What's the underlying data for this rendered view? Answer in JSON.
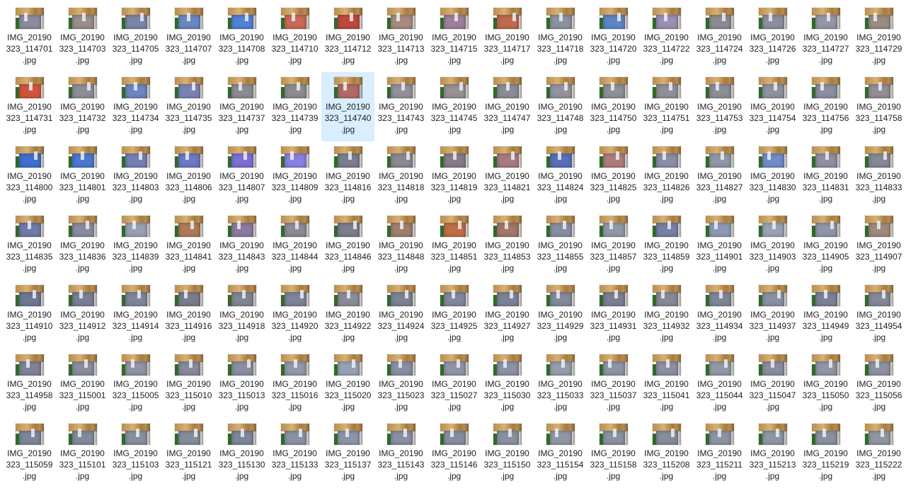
{
  "view": {
    "selected_file": "IMG_20190323_114740.jpg",
    "selected_color": "#cce8ff"
  },
  "files": [
    {
      "name": "IMG_20190323_114701.jpg",
      "thumb_color": "#8e8aa0"
    },
    {
      "name": "IMG_20190323_114703.jpg",
      "thumb_color": "#9a8e8c"
    },
    {
      "name": "IMG_20190323_114705.jpg",
      "thumb_color": "#7b86a8"
    },
    {
      "name": "IMG_20190323_114707.jpg",
      "thumb_color": "#6a86c2"
    },
    {
      "name": "IMG_20190323_114708.jpg",
      "thumb_color": "#4f82d6"
    },
    {
      "name": "IMG_20190323_114710.jpg",
      "thumb_color": "#c86a55"
    },
    {
      "name": "IMG_20190323_114712.jpg",
      "thumb_color": "#c0473f"
    },
    {
      "name": "IMG_20190323_114713.jpg",
      "thumb_color": "#a88a80"
    },
    {
      "name": "IMG_20190323_114715.jpg",
      "thumb_color": "#9f7f9a"
    },
    {
      "name": "IMG_20190323_114717.jpg",
      "thumb_color": "#c06b4c"
    },
    {
      "name": "IMG_20190323_114718.jpg",
      "thumb_color": "#8b92a2"
    },
    {
      "name": "IMG_20190323_114720.jpg",
      "thumb_color": "#5c86c4"
    },
    {
      "name": "IMG_20190323_114722.jpg",
      "thumb_color": "#9b8fb4"
    },
    {
      "name": "IMG_20190323_114724.jpg",
      "thumb_color": "#8c8a92"
    },
    {
      "name": "IMG_20190323_114726.jpg",
      "thumb_color": "#8c8fa0"
    },
    {
      "name": "IMG_20190323_114727.jpg",
      "thumb_color": "#9497a6"
    },
    {
      "name": "IMG_20190323_114729.jpg",
      "thumb_color": "#9a8c84"
    },
    {
      "name": "IMG_20190323_114731.jpg",
      "thumb_color": "#d0553f"
    },
    {
      "name": "IMG_20190323_114732.jpg",
      "thumb_color": "#8f8e98"
    },
    {
      "name": "IMG_20190323_114734.jpg",
      "thumb_color": "#6d86c0"
    },
    {
      "name": "IMG_20190323_114735.jpg",
      "thumb_color": "#7a84b4"
    },
    {
      "name": "IMG_20190323_114737.jpg",
      "thumb_color": "#8e8c92"
    },
    {
      "name": "IMG_20190323_114739.jpg",
      "thumb_color": "#8e8b90"
    },
    {
      "name": "IMG_20190323_114740.jpg",
      "thumb_color": "#b26a66"
    },
    {
      "name": "IMG_20190323_114743.jpg",
      "thumb_color": "#92909a"
    },
    {
      "name": "IMG_20190323_114745.jpg",
      "thumb_color": "#9a9094"
    },
    {
      "name": "IMG_20190323_114747.jpg",
      "thumb_color": "#8c8c96"
    },
    {
      "name": "IMG_20190323_114748.jpg",
      "thumb_color": "#9494a0"
    },
    {
      "name": "IMG_20190323_114750.jpg",
      "thumb_color": "#8e9098"
    },
    {
      "name": "IMG_20190323_114751.jpg",
      "thumb_color": "#90909a"
    },
    {
      "name": "IMG_20190323_114753.jpg",
      "thumb_color": "#8e8e98"
    },
    {
      "name": "IMG_20190323_114754.jpg",
      "thumb_color": "#8f92a0"
    },
    {
      "name": "IMG_20190323_114756.jpg",
      "thumb_color": "#8a8e9e"
    },
    {
      "name": "IMG_20190323_114758.jpg",
      "thumb_color": "#928e94"
    },
    {
      "name": "IMG_20190323_114800.jpg",
      "thumb_color": "#3f6fd0"
    },
    {
      "name": "IMG_20190323_114801.jpg",
      "thumb_color": "#4a78d2"
    },
    {
      "name": "IMG_20190323_114803.jpg",
      "thumb_color": "#7480b4"
    },
    {
      "name": "IMG_20190323_114806.jpg",
      "thumb_color": "#6b79c6"
    },
    {
      "name": "IMG_20190323_114807.jpg",
      "thumb_color": "#7c6fd8"
    },
    {
      "name": "IMG_20190323_114809.jpg",
      "thumb_color": "#8a80e0"
    },
    {
      "name": "IMG_20190323_114816.jpg",
      "thumb_color": "#7a7e8e"
    },
    {
      "name": "IMG_20190323_114818.jpg",
      "thumb_color": "#8a8890"
    },
    {
      "name": "IMG_20190323_114819.jpg",
      "thumb_color": "#857d86"
    },
    {
      "name": "IMG_20190323_114821.jpg",
      "thumb_color": "#a87b82"
    },
    {
      "name": "IMG_20190323_114824.jpg",
      "thumb_color": "#5a6fb8"
    },
    {
      "name": "IMG_20190323_114825.jpg",
      "thumb_color": "#b07c7a"
    },
    {
      "name": "IMG_20190323_114826.jpg",
      "thumb_color": "#8a8ea6"
    },
    {
      "name": "IMG_20190323_114827.jpg",
      "thumb_color": "#9098a8"
    },
    {
      "name": "IMG_20190323_114830.jpg",
      "thumb_color": "#6e8cc8"
    },
    {
      "name": "IMG_20190323_114831.jpg",
      "thumb_color": "#8e90a0"
    },
    {
      "name": "IMG_20190323_114833.jpg",
      "thumb_color": "#868894"
    },
    {
      "name": "IMG_20190323_114835.jpg",
      "thumb_color": "#6f7aa8"
    },
    {
      "name": "IMG_20190323_114836.jpg",
      "thumb_color": "#8a8aa0"
    },
    {
      "name": "IMG_20190323_114839.jpg",
      "thumb_color": "#9aa0b4"
    },
    {
      "name": "IMG_20190323_114841.jpg",
      "thumb_color": "#b07a58"
    },
    {
      "name": "IMG_20190323_114843.jpg",
      "thumb_color": "#8c7aa0"
    },
    {
      "name": "IMG_20190323_114844.jpg",
      "thumb_color": "#8e8a96"
    },
    {
      "name": "IMG_20190323_114846.jpg",
      "thumb_color": "#7c7e8c"
    },
    {
      "name": "IMG_20190323_114848.jpg",
      "thumb_color": "#a07e6c"
    },
    {
      "name": "IMG_20190323_114851.jpg",
      "thumb_color": "#c06c48"
    },
    {
      "name": "IMG_20190323_114853.jpg",
      "thumb_color": "#a07868"
    },
    {
      "name": "IMG_20190323_114855.jpg",
      "thumb_color": "#8a8ca0"
    },
    {
      "name": "IMG_20190323_114857.jpg",
      "thumb_color": "#9098a8"
    },
    {
      "name": "IMG_20190323_114859.jpg",
      "thumb_color": "#7680a4"
    },
    {
      "name": "IMG_20190323_114901.jpg",
      "thumb_color": "#8c9ab8"
    },
    {
      "name": "IMG_20190323_114903.jpg",
      "thumb_color": "#9aa2b4"
    },
    {
      "name": "IMG_20190323_114905.jpg",
      "thumb_color": "#9096a6"
    },
    {
      "name": "IMG_20190323_114907.jpg",
      "thumb_color": "#a08a7c"
    },
    {
      "name": "IMG_20190323_114910.jpg",
      "thumb_color": "#6c7894"
    },
    {
      "name": "IMG_20190323_114912.jpg",
      "thumb_color": "#7a8094"
    },
    {
      "name": "IMG_20190323_114914.jpg",
      "thumb_color": "#7e869c"
    },
    {
      "name": "IMG_20190323_114916.jpg",
      "thumb_color": "#7a7c8c"
    },
    {
      "name": "IMG_20190323_114918.jpg",
      "thumb_color": "#828494"
    },
    {
      "name": "IMG_20190323_114920.jpg",
      "thumb_color": "#7c8498"
    },
    {
      "name": "IMG_20190323_114922.jpg",
      "thumb_color": "#8a8c98"
    },
    {
      "name": "IMG_20190323_114924.jpg",
      "thumb_color": "#7e8294"
    },
    {
      "name": "IMG_20190323_114925.jpg",
      "thumb_color": "#80889c"
    },
    {
      "name": "IMG_20190323_114927.jpg",
      "thumb_color": "#7c8296"
    },
    {
      "name": "IMG_20190323_114929.jpg",
      "thumb_color": "#828a9c"
    },
    {
      "name": "IMG_20190323_114931.jpg",
      "thumb_color": "#7a8092"
    },
    {
      "name": "IMG_20190323_114932.jpg",
      "thumb_color": "#868a98"
    },
    {
      "name": "IMG_20190323_114934.jpg",
      "thumb_color": "#7e8698"
    },
    {
      "name": "IMG_20190323_114937.jpg",
      "thumb_color": "#8890a2"
    },
    {
      "name": "IMG_20190323_114949.jpg",
      "thumb_color": "#7a8296"
    },
    {
      "name": "IMG_20190323_114954.jpg",
      "thumb_color": "#848898"
    },
    {
      "name": "IMG_20190323_114958.jpg",
      "thumb_color": "#7e8496"
    },
    {
      "name": "IMG_20190323_115001.jpg",
      "thumb_color": "#8a8e9c"
    },
    {
      "name": "IMG_20190323_115005.jpg",
      "thumb_color": "#9094a4"
    },
    {
      "name": "IMG_20190323_115010.jpg",
      "thumb_color": "#868a9a"
    },
    {
      "name": "IMG_20190323_115013.jpg",
      "thumb_color": "#8a8e9e"
    },
    {
      "name": "IMG_20190323_115016.jpg",
      "thumb_color": "#9298a8"
    },
    {
      "name": "IMG_20190323_115020.jpg",
      "thumb_color": "#98a0b4"
    },
    {
      "name": "IMG_20190323_115023.jpg",
      "thumb_color": "#8a90a2"
    },
    {
      "name": "IMG_20190323_115027.jpg",
      "thumb_color": "#9094a6"
    },
    {
      "name": "IMG_20190323_115030.jpg",
      "thumb_color": "#8c92a4"
    },
    {
      "name": "IMG_20190323_115033.jpg",
      "thumb_color": "#969caa"
    },
    {
      "name": "IMG_20190323_115037.jpg",
      "thumb_color": "#8e94a4"
    },
    {
      "name": "IMG_20190323_115041.jpg",
      "thumb_color": "#8c90a0"
    },
    {
      "name": "IMG_20190323_115044.jpg",
      "thumb_color": "#9298a6"
    },
    {
      "name": "IMG_20190323_115047.jpg",
      "thumb_color": "#8a8e9c"
    },
    {
      "name": "IMG_20190323_115050.jpg",
      "thumb_color": "#9096a4"
    },
    {
      "name": "IMG_20190323_115056.jpg",
      "thumb_color": "#8e92a0"
    },
    {
      "name": "IMG_20190323_115059.jpg",
      "thumb_color": "#7c8698"
    },
    {
      "name": "IMG_20190323_115101.jpg",
      "thumb_color": "#828a9c"
    },
    {
      "name": "IMG_20190323_115103.jpg",
      "thumb_color": "#8890a0"
    },
    {
      "name": "IMG_20190323_115121.jpg",
      "thumb_color": "#868c9a"
    },
    {
      "name": "IMG_20190323_115130.jpg",
      "thumb_color": "#7e8698"
    },
    {
      "name": "IMG_20190323_115133.jpg",
      "thumb_color": "#8a92a4"
    },
    {
      "name": "IMG_20190323_115137.jpg",
      "thumb_color": "#8c94a6"
    },
    {
      "name": "IMG_20190323_115143.jpg",
      "thumb_color": "#8890a2"
    },
    {
      "name": "IMG_20190323_115146.jpg",
      "thumb_color": "#868e9e"
    },
    {
      "name": "IMG_20190323_115150.jpg",
      "thumb_color": "#8a90a0"
    },
    {
      "name": "IMG_20190323_115154.jpg",
      "thumb_color": "#9096a6"
    },
    {
      "name": "IMG_20190323_115158.jpg",
      "thumb_color": "#8a92a2"
    },
    {
      "name": "IMG_20190323_115208.jpg",
      "thumb_color": "#868c9c"
    },
    {
      "name": "IMG_20190323_115211.jpg",
      "thumb_color": "#8c94a4"
    },
    {
      "name": "IMG_20190323_115213.jpg",
      "thumb_color": "#8e96a6"
    },
    {
      "name": "IMG_20190323_115219.jpg",
      "thumb_color": "#8a90a0"
    },
    {
      "name": "IMG_20190323_115222.jpg",
      "thumb_color": "#9096a2"
    }
  ]
}
